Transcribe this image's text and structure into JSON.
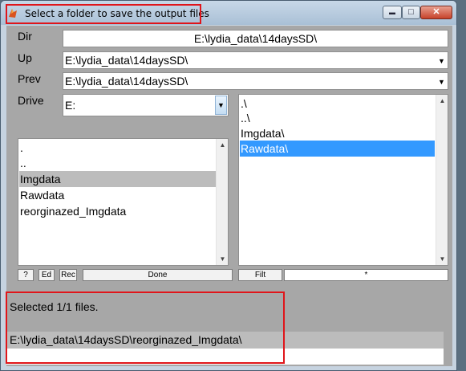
{
  "window": {
    "title": "Select a folder to save the output files",
    "controls": {
      "minimize": "▬",
      "maximize": "□",
      "close": "✕"
    },
    "highlight_color": "#e0151a"
  },
  "form": {
    "dir_label": "Dir",
    "dir_value": "E:\\lydia_data\\14daysSD\\",
    "up_label": "Up",
    "up_value": "E:\\lydia_data\\14daysSD\\",
    "prev_label": "Prev",
    "prev_value": "E:\\lydia_data\\14daysSD\\",
    "drive_label": "Drive",
    "drive_value": "E:"
  },
  "left_list": {
    "items": [
      ".",
      "..",
      "Imgdata",
      "Rawdata",
      "reorginazed_Imgdata"
    ],
    "selected_index": 2
  },
  "right_list": {
    "items": [
      ".\\",
      "..\\",
      "Imgdata\\",
      "Rawdata\\"
    ],
    "selected_index": 3,
    "selected_color": "#3399ff"
  },
  "buttons": {
    "help": "?",
    "edit": "Ed",
    "rec": "Rec",
    "done": "Done",
    "filter": "Filt",
    "filter_value": "*"
  },
  "status": {
    "message": "Selected 1/1 files.",
    "selected_path": "E:\\lydia_data\\14daysSD\\reorginazed_Imgdata\\"
  },
  "icons": {
    "app": "matlab-icon",
    "dropdown": "triangle-down-icon",
    "scroll_up": "triangle-up-icon",
    "scroll_down": "triangle-down-icon"
  }
}
